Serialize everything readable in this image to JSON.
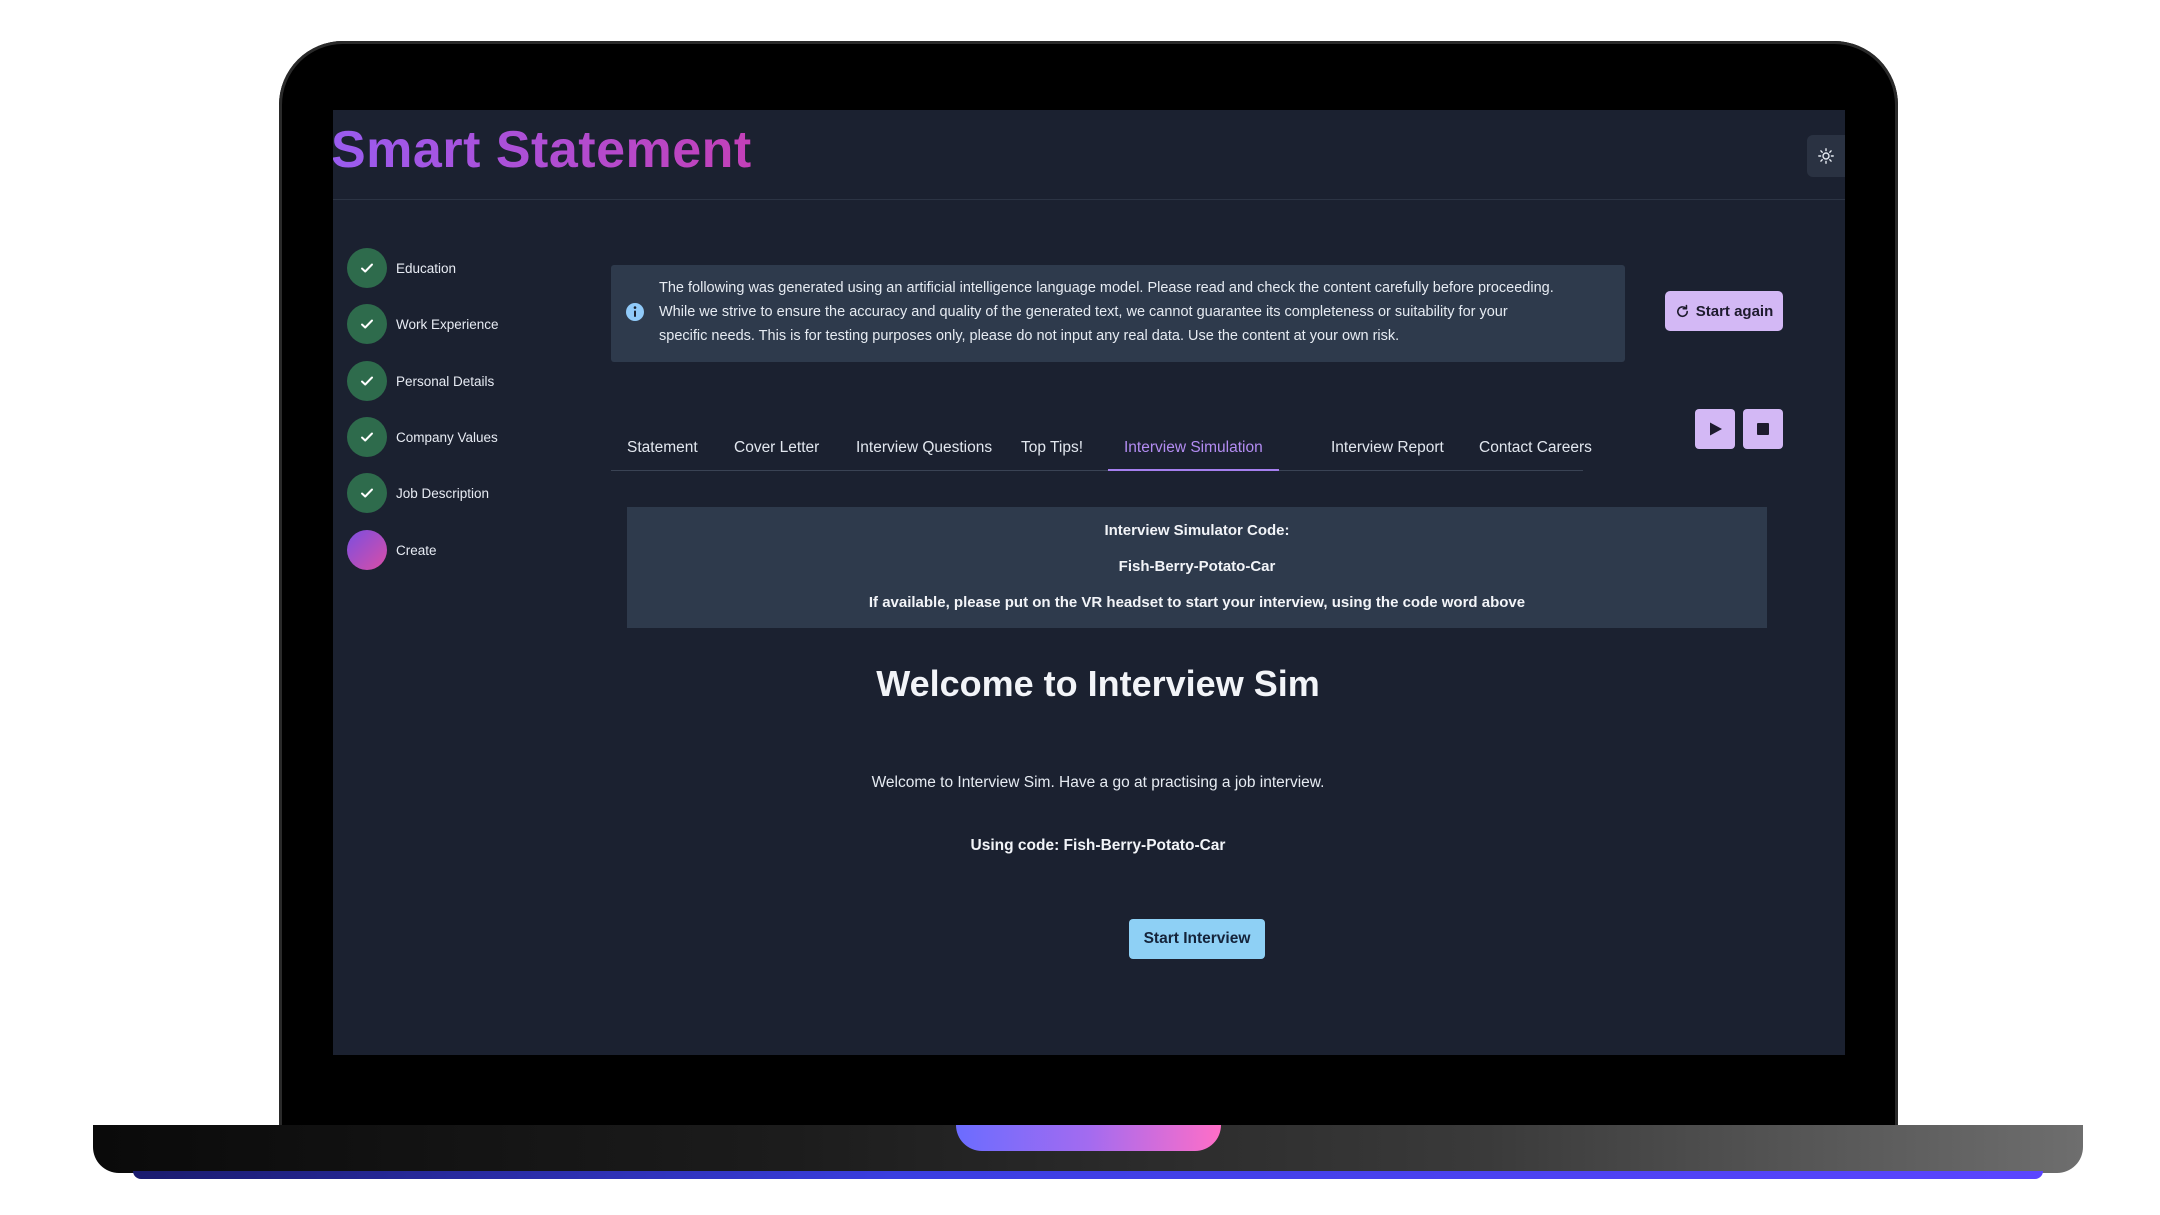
{
  "app": {
    "title": "Smart Statement"
  },
  "header": {
    "theme_toggle_icon": "sun-icon"
  },
  "steps": [
    {
      "label": "Education",
      "state": "complete",
      "icon": "check-icon"
    },
    {
      "label": "Work Experience",
      "state": "complete",
      "icon": "check-icon"
    },
    {
      "label": "Personal Details",
      "state": "complete",
      "icon": "check-icon"
    },
    {
      "label": "Company Values",
      "state": "complete",
      "icon": "check-icon"
    },
    {
      "label": "Job Description",
      "state": "complete",
      "icon": "check-icon"
    },
    {
      "label": "Create",
      "state": "active",
      "icon": ""
    }
  ],
  "notice": {
    "icon": "info-icon",
    "lines": [
      "The following was generated using an artificial intelligence language model. Please read and check the content carefully before proceeding.",
      "While we strive to ensure the accuracy and quality of the generated text, we cannot guarantee its completeness or suitability for your",
      "specific needs. This is for testing purposes only, please do not input any real data. Use the content at your own risk."
    ]
  },
  "actions": {
    "start_again_label": "Start again",
    "start_again_icon": "refresh-icon"
  },
  "media": {
    "play_icon": "play-icon",
    "stop_icon": "stop-icon"
  },
  "tabs": [
    {
      "label": "Statement",
      "active": false
    },
    {
      "label": "Cover Letter",
      "active": false
    },
    {
      "label": "Interview Questions",
      "active": false
    },
    {
      "label": "Top Tips!",
      "active": false
    },
    {
      "label": "Interview Simulation",
      "active": true
    },
    {
      "label": "Interview Report",
      "active": false
    },
    {
      "label": "Contact Careers",
      "active": false
    }
  ],
  "simulator": {
    "code_heading": "Interview Simulator Code:",
    "code": "Fish-Berry-Potato-Car",
    "instruction": "If available, please put on the VR headset to start your interview, using the code word above",
    "welcome_title": "Welcome to Interview Sim",
    "welcome_text": "Welcome to Interview Sim. Have a go at practising a job interview.",
    "using_code": "Using code: Fish-Berry-Potato-Car",
    "start_button": "Start Interview"
  },
  "colors": {
    "background": "#1b2130",
    "panel": "#2e3a4c",
    "step_complete": "#2e6b4c",
    "accent": "#b38cf2",
    "button_lilac": "#d3b8f5",
    "button_blue": "#8ed0f5"
  }
}
